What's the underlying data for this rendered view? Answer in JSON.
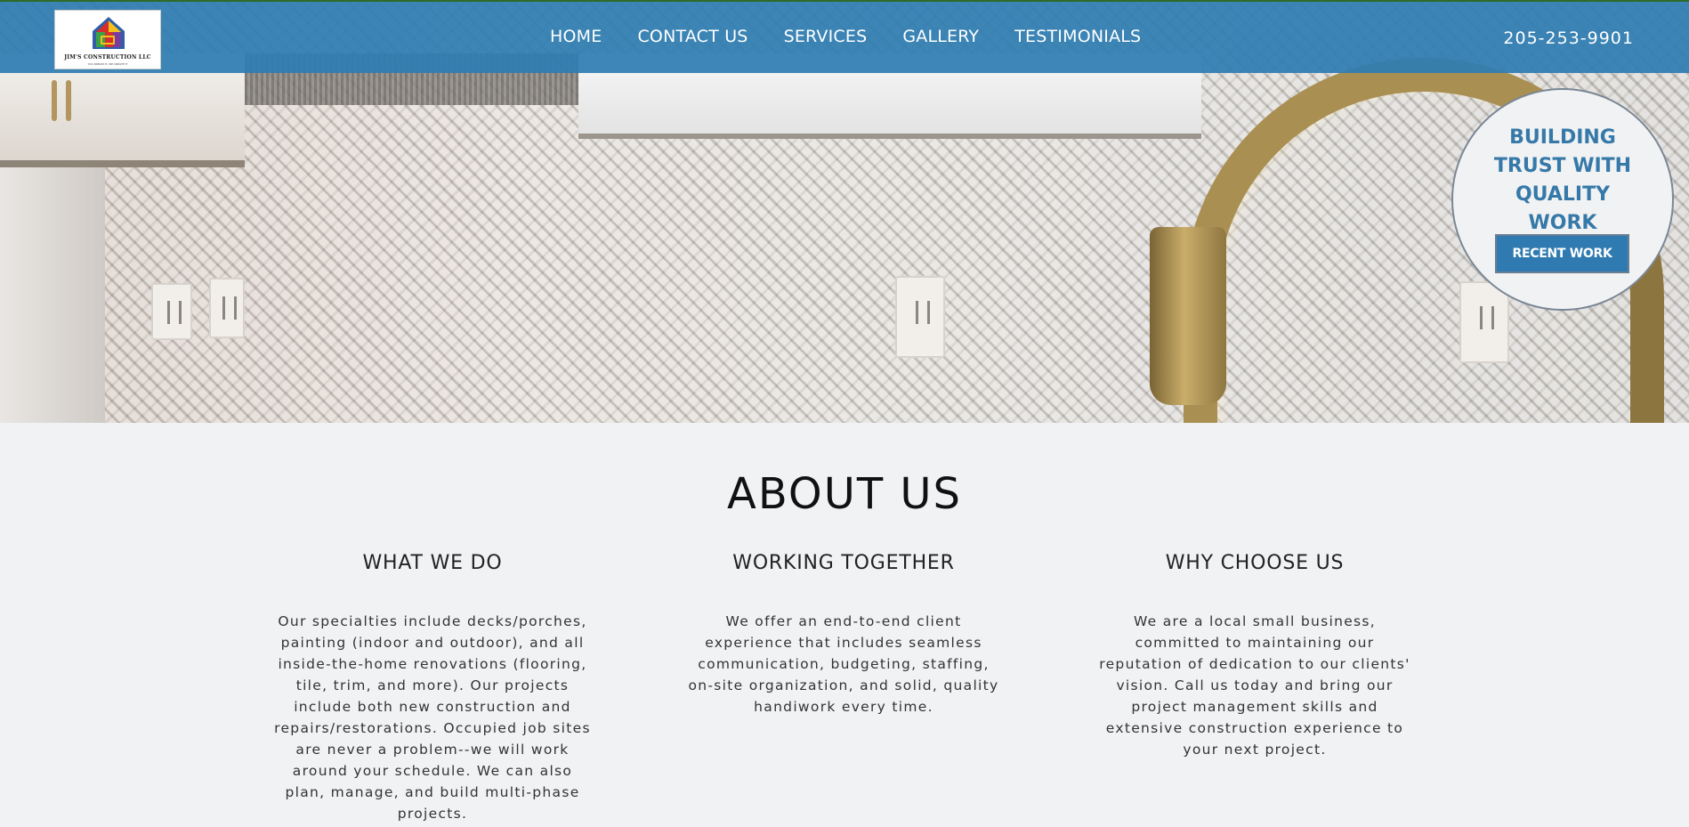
{
  "logo": {
    "company_name": "JIM'S CONSTRUCTION LLC",
    "tagline": "YOU DREAM IT, WE CREATE IT",
    "colors": [
      "#2e5fa8",
      "#d62d2d",
      "#f2c21b",
      "#3aa149",
      "#7a3c9e"
    ]
  },
  "nav": {
    "items": [
      {
        "label": "HOME"
      },
      {
        "label": "CONTACT US"
      },
      {
        "label": "SERVICES"
      },
      {
        "label": "GALLERY"
      },
      {
        "label": "TESTIMONIALS"
      }
    ],
    "phone": "205-253-9901"
  },
  "hero": {
    "badge_title": "BUILDING TRUST WITH QUALITY WORK",
    "badge_button": "RECENT WORK"
  },
  "about": {
    "title": "ABOUT US",
    "columns": [
      {
        "heading": "WHAT WE DO",
        "text": "Our specialties include decks/porches, painting (indoor and outdoor), and all inside-the-home renovations (flooring, tile, trim, and more). Our projects include both new construction and repairs/restorations. Occupied job sites are never a problem--we will work around your schedule. We can also plan, manage, and build multi-phase projects."
      },
      {
        "heading": "WORKING TOGETHER",
        "text": "We offer an end-to-end client experience that includes seamless communication, budgeting, staffing, on-site organization, and solid, quality handiwork every time."
      },
      {
        "heading": "WHY CHOOSE US",
        "text": "We are a local small business, committed to maintaining our reputation of dedication to our clients' vision. Call us today and bring our project management skills and extensive construction experience to your next project."
      }
    ]
  },
  "colors": {
    "nav_bg": "#2e7db1",
    "accent": "#3679a8",
    "page_bg": "#f1f2f4"
  }
}
